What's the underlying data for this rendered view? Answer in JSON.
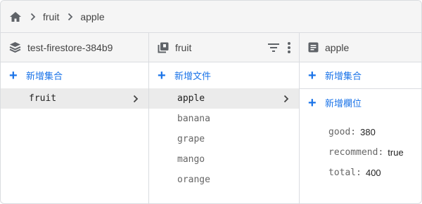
{
  "breadcrumb": {
    "items": [
      "fruit",
      "apple"
    ]
  },
  "panels": {
    "root": {
      "title": "test-firestore-384b9",
      "add_label": "新增集合",
      "items": [
        "fruit"
      ]
    },
    "collection": {
      "title": "fruit",
      "add_label": "新增文件",
      "items": [
        "apple",
        "banana",
        "grape",
        "mango",
        "orange"
      ]
    },
    "document": {
      "title": "apple",
      "add_collection_label": "新增集合",
      "add_field_label": "新增欄位",
      "fields": [
        {
          "key": "good:",
          "value": "380"
        },
        {
          "key": "recommend:",
          "value": "true"
        },
        {
          "key": "total:",
          "value": "400"
        }
      ]
    }
  },
  "icons": {
    "home": "home-icon",
    "separator": "chevron-right-icon",
    "database": "database-stack-icon",
    "collection": "collection-icon",
    "filter": "filter-icon",
    "more": "more-vert-icon",
    "document": "document-icon"
  },
  "colors": {
    "accent": "#1a73e8",
    "header_bg": "#f5f5f5",
    "selected_bg": "#ebebeb"
  }
}
